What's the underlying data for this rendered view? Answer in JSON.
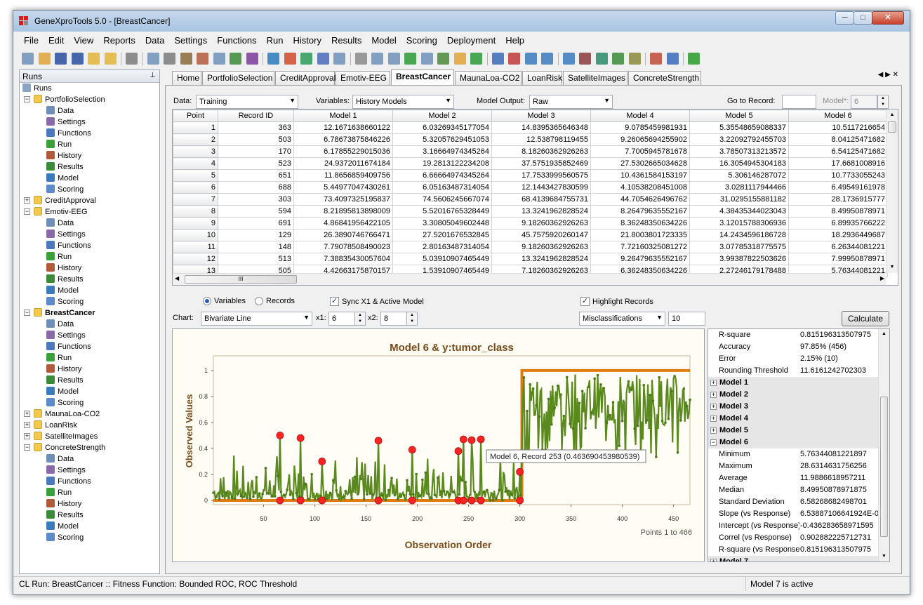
{
  "window": {
    "title": "GeneXproTools 5.0 - [BreastCancer]",
    "min_label": "─",
    "max_label": "□",
    "close_label": "✕"
  },
  "menu": [
    "File",
    "Edit",
    "View",
    "Reports",
    "Data",
    "Settings",
    "Functions",
    "Run",
    "History",
    "Results",
    "Model",
    "Scoring",
    "Deployment",
    "Help"
  ],
  "runs_panel": {
    "title": "Runs",
    "pin": "📌",
    "root": "Runs",
    "projects": [
      {
        "name": "PortfolioSelection",
        "expanded": true,
        "bold": false,
        "children": [
          "Data",
          "Settings",
          "Functions",
          "Run",
          "History",
          "Results",
          "Model",
          "Scoring"
        ]
      },
      {
        "name": "CreditApproval",
        "expanded": false,
        "bold": false,
        "children": []
      },
      {
        "name": "Emotiv-EEG",
        "expanded": true,
        "bold": false,
        "children": [
          "Data",
          "Settings",
          "Functions",
          "Run",
          "History",
          "Results",
          "Model",
          "Scoring"
        ]
      },
      {
        "name": "BreastCancer",
        "expanded": true,
        "bold": true,
        "children": [
          "Data",
          "Settings",
          "Functions",
          "Run",
          "History",
          "Results",
          "Model",
          "Scoring"
        ]
      },
      {
        "name": "MaunaLoa-CO2",
        "expanded": false,
        "bold": false,
        "children": []
      },
      {
        "name": "LoanRisk",
        "expanded": false,
        "bold": false,
        "children": []
      },
      {
        "name": "SatelliteImages",
        "expanded": false,
        "bold": false,
        "children": []
      },
      {
        "name": "ConcreteStrength",
        "expanded": true,
        "bold": false,
        "children": [
          "Data",
          "Settings",
          "Functions",
          "Run",
          "History",
          "Results",
          "Model",
          "Scoring"
        ]
      }
    ]
  },
  "tabs": [
    "Home",
    "PortfolioSelection",
    "CreditApproval",
    "Emotiv-EEG",
    "BreastCancer",
    "MaunaLoa-CO2",
    "LoanRisk",
    "SatelliteImages",
    "ConcreteStrength"
  ],
  "active_tab": "BreastCancer",
  "controls": {
    "data_label": "Data:",
    "data_value": "Training",
    "variables_label": "Variables:",
    "variables_value": "History Models",
    "model_output_label": "Model Output:",
    "model_output_value": "Raw",
    "goto_label": "Go to Record:",
    "goto_value": "",
    "model_label": "Model*:",
    "model_value": "6"
  },
  "grid": {
    "columns": [
      "Point",
      "Record ID",
      "Model 1",
      "Model 2",
      "Model 3",
      "Model 4",
      "Model 5",
      "Model 6"
    ],
    "rows": [
      [
        "1",
        "363",
        "12.1671638660122",
        "6.03269345177054",
        "14.8395365646348",
        "9.0785459981931",
        "5.35548659088337",
        "10.5117216654"
      ],
      [
        "2",
        "503",
        "6.78673875846226",
        "5.32057629451053",
        "12.538798119455",
        "9.26065694255902",
        "3.22092792455703",
        "8.04125471682"
      ],
      [
        "3",
        "170",
        "6.17855229015036",
        "3.16664974345264",
        "8.18260362926263",
        "7.7005945781678",
        "3.78507313213572",
        "6.54125471682"
      ],
      [
        "4",
        "523",
        "24.9372011674184",
        "19.2813122234208",
        "37.5751935852469",
        "27.5302665034628",
        "16.3054945304183",
        "17.6681008916"
      ],
      [
        "5",
        "651",
        "11.8656859409756",
        "6.66664974345264",
        "17.7533999560575",
        "10.4361584153197",
        "5.306146287072",
        "10.7733055243"
      ],
      [
        "6",
        "688",
        "5.44977047430261",
        "6.05163487314054",
        "12.1443427830599",
        "4.10538208451008",
        "3.0281117944466",
        "6.49549161978"
      ],
      [
        "7",
        "303",
        "73.4097325195837",
        "74.5606245667074",
        "68.4139684755731",
        "44.7054626496762",
        "31.0295155881182",
        "28.1736915777"
      ],
      [
        "8",
        "594",
        "8.21895813898009",
        "5.52016765328449",
        "13.3241962828524",
        "8.26479635552167",
        "4.38435344023043",
        "8.49950878971"
      ],
      [
        "9",
        "691",
        "4.86841956422105",
        "3.30805049602448",
        "9.18260362926263",
        "8.36248350634226",
        "3.12015788306936",
        "6.89935766222"
      ],
      [
        "10",
        "129",
        "26.3890746766471",
        "27.5201676532845",
        "45.7575920260147",
        "21.8003801723335",
        "14.2434596186728",
        "18.2936449687"
      ],
      [
        "11",
        "148",
        "7.79078508490023",
        "2.80163487314054",
        "9.18260362926263",
        "7.72160325081272",
        "3.07785318775575",
        "6.26344081221"
      ],
      [
        "12",
        "513",
        "7.38835430057604",
        "5.03910907465449",
        "13.3241962828524",
        "9.26479635552167",
        "3.99387822503626",
        "7.99950878971"
      ],
      [
        "13",
        "505",
        "4.42663175870157",
        "1.53910907465449",
        "7.18260362926263",
        "6.36248350634226",
        "2.27246179178488",
        "5.76344081221"
      ]
    ],
    "hscroll_thumb_label": "III"
  },
  "chart_controls": {
    "variables_radio": "Variables",
    "records_radio": "Records",
    "sync_label": "Sync X1 & Active Model",
    "highlight_label": "Highlight Records",
    "chart_label": "Chart:",
    "chart_value": "Bivariate Line",
    "x1_label": "x1:",
    "x1_value": "6",
    "x2_label": "x2:",
    "x2_value": "8",
    "highlight_value": "Misclassifications",
    "highlight_count": "10",
    "calculate_label": "Calculate"
  },
  "chart_data": {
    "type": "line",
    "title": "Model 6 & y:tumor_class",
    "xlabel": "Observation Order",
    "ylabel": "Observed Values",
    "xlim": [
      1,
      466
    ],
    "ylim": [
      0,
      1
    ],
    "x_ticks": [
      "50",
      "100",
      "150",
      "200",
      "250",
      "300",
      "350",
      "400",
      "450"
    ],
    "y_ticks": [
      "0",
      "0.2",
      "0.4",
      "0.6",
      "0.8",
      "1"
    ],
    "class_switch_x": 302,
    "series": [
      {
        "name": "Model 6",
        "color": "#5a8a1e"
      },
      {
        "name": "y:tumor_class",
        "color": "#e07b10"
      }
    ],
    "highlight_color": "#ff2222",
    "misclassified": [
      {
        "x": 66,
        "y": 0.5
      },
      {
        "x": 86,
        "y": 0.48
      },
      {
        "x": 107,
        "y": 0.3
      },
      {
        "x": 162,
        "y": 0.46
      },
      {
        "x": 195,
        "y": 0.39
      },
      {
        "x": 240,
        "y": 0.38
      },
      {
        "x": 245,
        "y": 0.47
      },
      {
        "x": 253,
        "y": 0.464
      },
      {
        "x": 262,
        "y": 0.47
      },
      {
        "x": 300,
        "y": 0.22
      }
    ],
    "tooltip": "Model 6, Record 253 (0.463690453980539)",
    "range_label": "Points 1 to 466"
  },
  "stats": {
    "top_rows": [
      {
        "k": "R-square",
        "v": "0.815196313507975"
      },
      {
        "k": "Accuracy",
        "v": "97.85% (456)"
      },
      {
        "k": "Error",
        "v": "2.15% (10)"
      },
      {
        "k": "Rounding Threshold",
        "v": "11.6161242702303"
      }
    ],
    "groups": [
      "Model 1",
      "Model 2",
      "Model 3",
      "Model 4",
      "Model 5"
    ],
    "model6_title": "Model 6",
    "model6_rows": [
      {
        "k": "Minimum",
        "v": "5.76344081221897"
      },
      {
        "k": "Maximum",
        "v": "28.6314631756256"
      },
      {
        "k": "Average",
        "v": "11.9886618957211"
      },
      {
        "k": "Median",
        "v": "8.49950878971875"
      },
      {
        "k": "Standard Deviation",
        "v": "6.58268682498701"
      },
      {
        "k": "Slope (vs Response)",
        "v": "6.53887106641924E-0"
      },
      {
        "k": "Intercept (vs Response)",
        "v": "-0.436283658971595"
      },
      {
        "k": "Correl (vs Response)",
        "v": "0.902882225712731"
      },
      {
        "k": "R-square (vs Response)",
        "v": "0.815196313507975"
      }
    ],
    "next_group": "Model 7"
  },
  "status": {
    "left": "CL Run: BreastCancer :: Fitness Function: Bounded ROC, ROC Threshold",
    "right": "Model 7 is active"
  }
}
